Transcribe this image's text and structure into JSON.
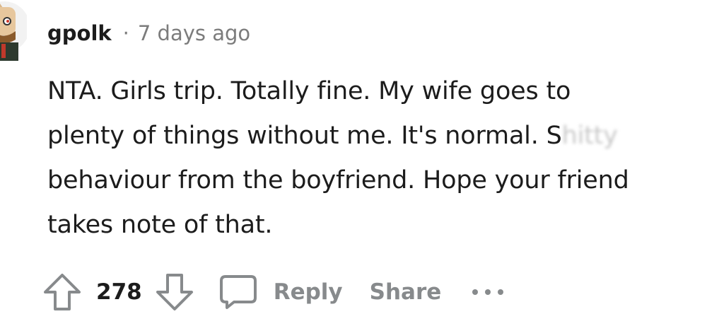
{
  "comment": {
    "author": "gpolk",
    "separator": "·",
    "timestamp": "7 days ago",
    "body_lines": [
      "NTA. Girls trip. Totally fine. My wife goes to",
      "plenty of things without me. It's normal. S",
      "behaviour from the boyfriend. Hope your friend",
      "takes note of that."
    ],
    "obscured_word": "hitty",
    "score": "278"
  },
  "actions": {
    "reply_label": "Reply",
    "share_label": "Share"
  },
  "icons": {
    "upvote": "arrow-up-icon",
    "downvote": "arrow-down-icon",
    "reply": "comment-bubble-icon",
    "more": "more-dots-icon"
  },
  "colors": {
    "text": "#1c1c1c",
    "muted": "#7c7c7c",
    "action": "#878a8c"
  }
}
